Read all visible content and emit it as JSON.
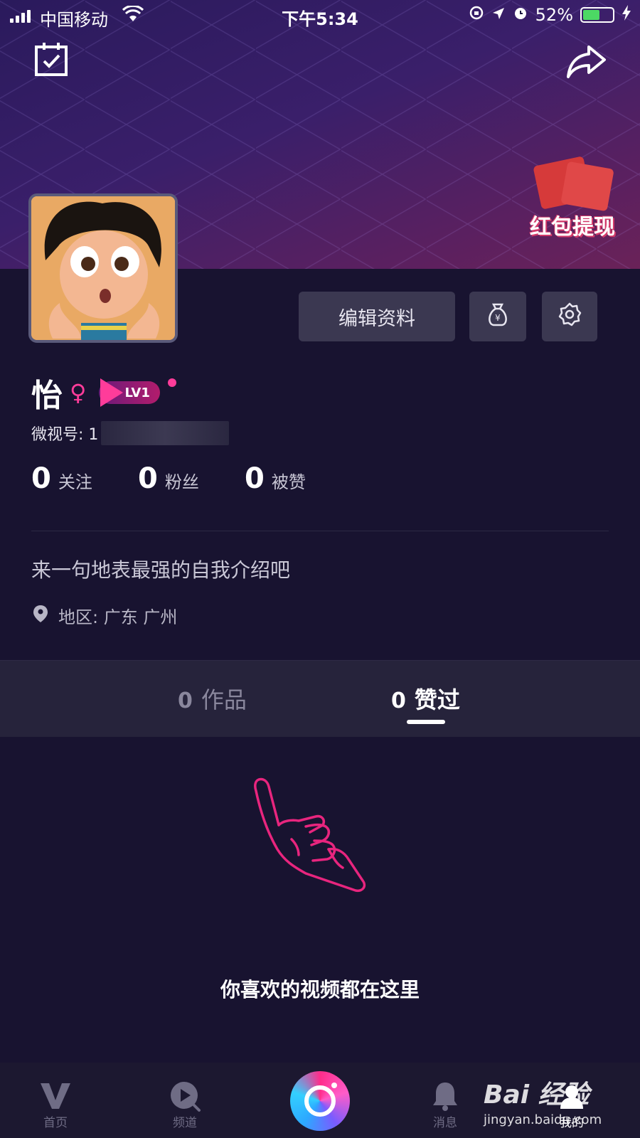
{
  "status_bar": {
    "carrier": "中国移动",
    "time": "下午5:34",
    "battery": "52%"
  },
  "header": {
    "red_packet_label": "红包提现"
  },
  "profile": {
    "edit_button_label": "编辑资料",
    "name": "怡",
    "gender_symbol": "♀",
    "level_badge": "LV1",
    "weishi_id_label": "微视号: 1",
    "stats": [
      {
        "num": "0",
        "label": "关注"
      },
      {
        "num": "0",
        "label": "粉丝"
      },
      {
        "num": "0",
        "label": "被赞"
      }
    ],
    "bio": "来一句地表最强的自我介绍吧",
    "region": "地区:  广东 广州"
  },
  "tabs": [
    {
      "count": "0",
      "label": "作品",
      "active": false
    },
    {
      "count": "0",
      "label": "赞过",
      "active": true
    }
  ],
  "empty_state": {
    "message": "你喜欢的视频都在这里"
  },
  "bottom_nav": {
    "items": [
      {
        "label": "首页",
        "icon": "v-logo-icon"
      },
      {
        "label": "频道",
        "icon": "channel-play-icon"
      },
      {
        "label": "消息",
        "icon": "bell-icon"
      },
      {
        "label": "我的",
        "icon": "profile-icon"
      }
    ]
  },
  "watermark": {
    "line1": "Bai 经验",
    "line2": "jingyan.baidu.com"
  },
  "colors": {
    "accent_pink": "#ff3c9a",
    "background": "#181330",
    "button_bg": "#3b3851"
  }
}
